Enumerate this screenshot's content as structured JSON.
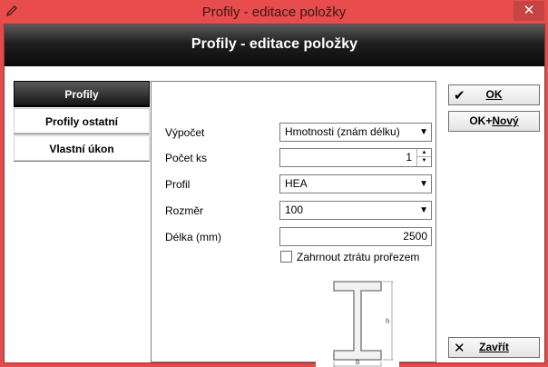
{
  "window": {
    "title": "Profily - editace položky",
    "close_glyph": "✕"
  },
  "header": {
    "title": "Profily - editace položky"
  },
  "sidebar": {
    "items": [
      {
        "label": "Profily",
        "active": true
      },
      {
        "label": "Profily ostatní",
        "active": false
      },
      {
        "label": "Vlastní úkon",
        "active": false
      }
    ]
  },
  "form": {
    "vypocet": {
      "label": "Výpočet",
      "value": "Hmotnosti (znám délku)"
    },
    "pocet_ks": {
      "label": "Počet ks",
      "value": "1"
    },
    "profil": {
      "label": "Profil",
      "value": "HEA"
    },
    "rozmer": {
      "label": "Rozměr",
      "value": "100"
    },
    "delka": {
      "label": "Délka (mm)",
      "value": "2500"
    },
    "zahrnout": {
      "label": "Zahrnout ztrátu prořezem",
      "checked": false
    },
    "diagram": {
      "h_label": "h",
      "b_label": "b"
    }
  },
  "buttons": {
    "ok": {
      "label": "OK",
      "icon": "checkmark-icon"
    },
    "ok_new_prefix": "OK+",
    "ok_new_label": "Nový",
    "close": {
      "label": "Zavřít",
      "icon": "close-icon"
    }
  },
  "colors": {
    "titlebar": "#e84c4c",
    "header_dark": "#0a0a0a"
  }
}
